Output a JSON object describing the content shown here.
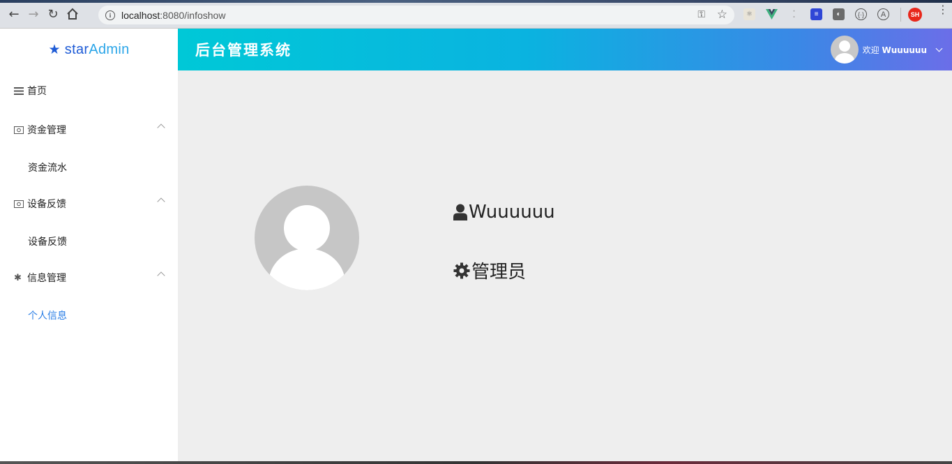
{
  "browser": {
    "url_host": "localhost",
    "url_rest": ":8080/infoshow",
    "ext_sh_label": "SH"
  },
  "sidebar": {
    "brand_part1": "star",
    "brand_part2": "Admin",
    "items": [
      {
        "label": "首页"
      },
      {
        "label": "资金管理",
        "sub": "资金流水"
      },
      {
        "label": "设备反馈",
        "sub": "设备反馈"
      },
      {
        "label": "信息管理",
        "sub": "个人信息"
      }
    ]
  },
  "header": {
    "title": "后台管理系统",
    "welcome": "欢迎",
    "username": "Wuuuuuu"
  },
  "profile": {
    "name": "Wuuuuuu",
    "role": "管理员"
  },
  "colors": {
    "accent": "#2a7ee6",
    "header_start": "#00c8d7",
    "header_end": "#6b6ee8"
  }
}
